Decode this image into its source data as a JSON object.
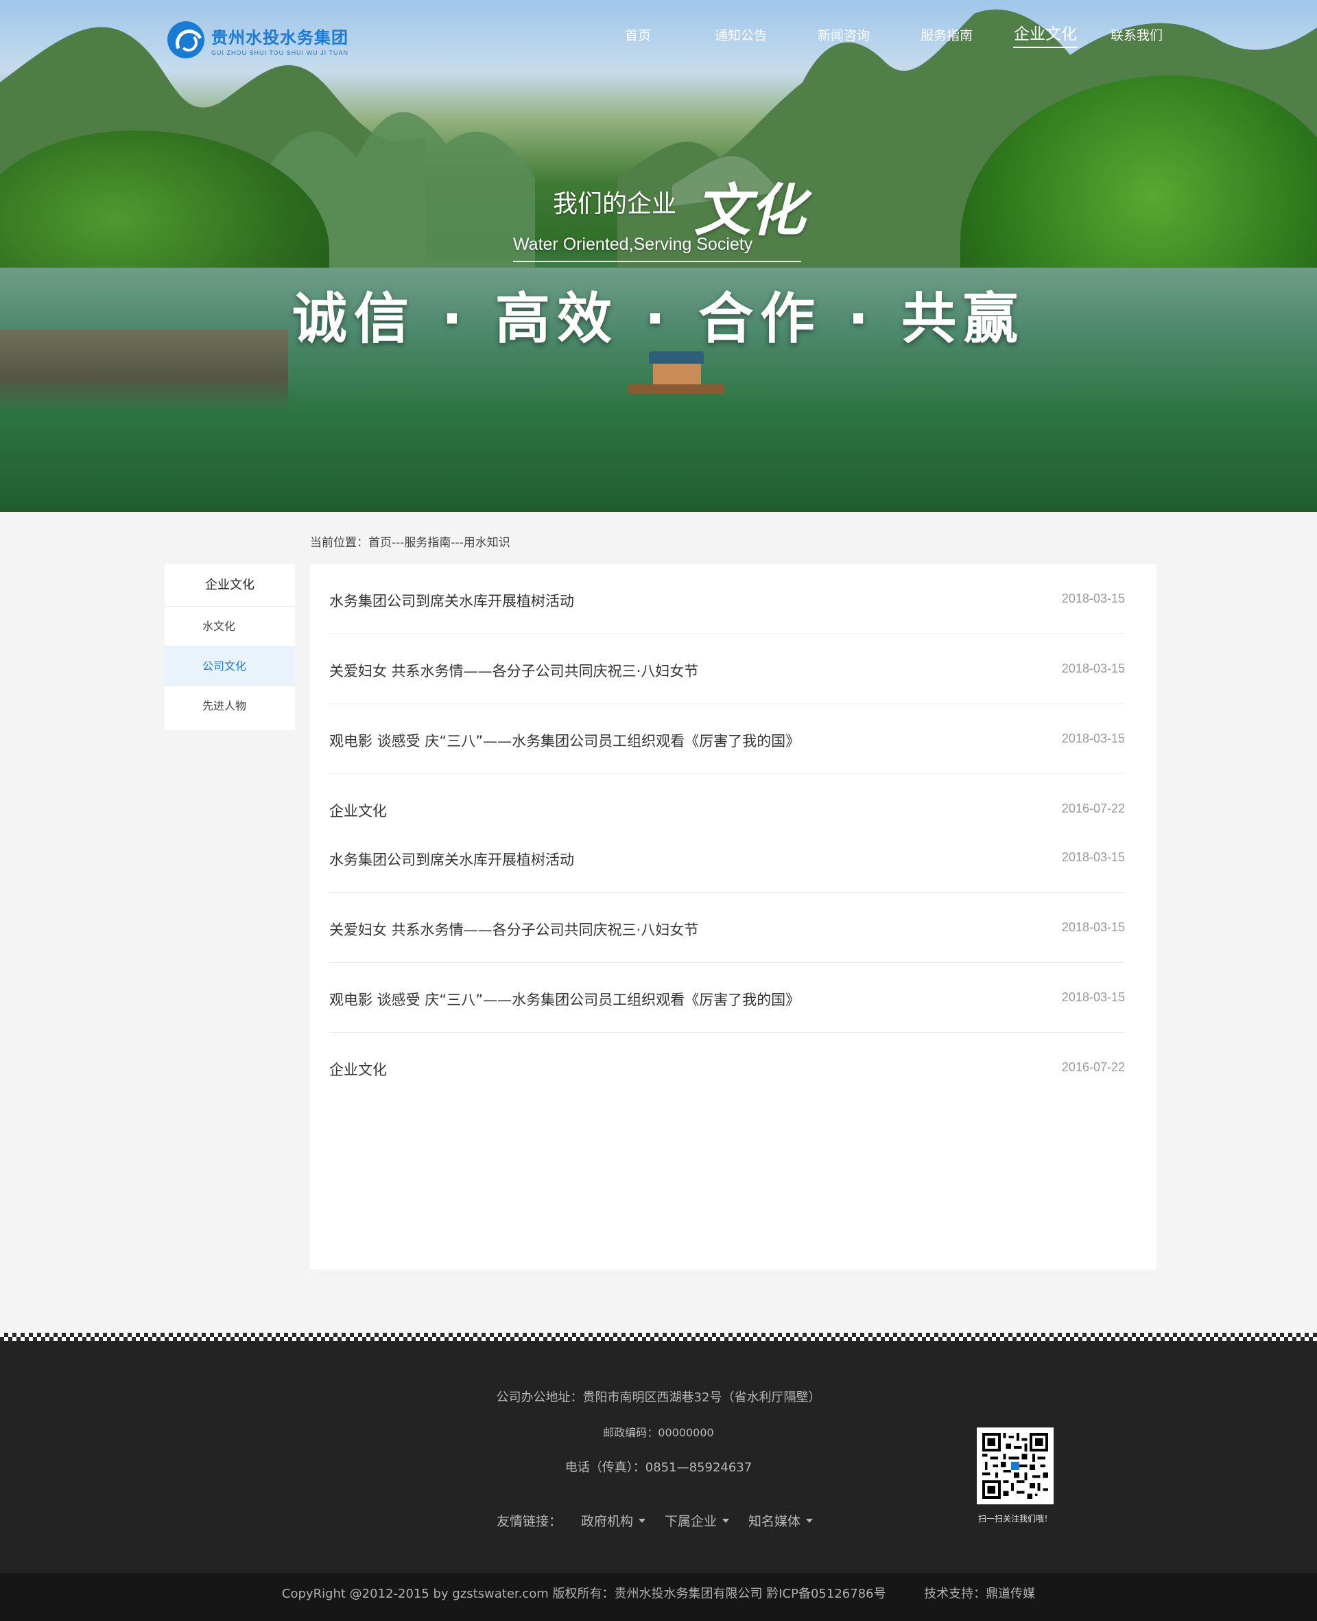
{
  "brand": {
    "name_cn": "贵州水投水务集团",
    "name_en": "GUI ZHOU SHUI TOU SHUI WU JI TUAN"
  },
  "nav": [
    {
      "label": "首页",
      "active": false
    },
    {
      "label": "通知公告",
      "active": false
    },
    {
      "label": "新闻咨询",
      "active": false
    },
    {
      "label": "服务指南",
      "active": false
    },
    {
      "label": "企业文化",
      "active": true
    },
    {
      "label": "联系我们",
      "active": false
    }
  ],
  "banner": {
    "line1": "我们的企业",
    "line1_big": "文化",
    "subtitle_en": "Water Oriented,Serving Society",
    "values": "诚信 · 高效 · 合作 · 共赢"
  },
  "breadcrumb": "当前位置：首页---服务指南---用水知识",
  "sidebar": {
    "title": "企业文化",
    "items": [
      {
        "label": "水文化",
        "active": false
      },
      {
        "label": "公司文化",
        "active": true
      },
      {
        "label": "先进人物",
        "active": false
      }
    ]
  },
  "news": [
    {
      "title": "水务集团公司到席关水库开展植树活动",
      "date": "2018-03-15"
    },
    {
      "title": "关爱妇女 共系水务情——各分子公司共同庆祝三·八妇女节",
      "date": "2018-03-15"
    },
    {
      "title": "观电影 谈感受 庆“三八”——水务集团公司员工组织观看《厉害了我的国》",
      "date": "2018-03-15"
    },
    {
      "title": "企业文化",
      "date": "2016-07-22"
    },
    {
      "title": "水务集团公司到席关水库开展植树活动",
      "date": "2018-03-15"
    },
    {
      "title": "关爱妇女 共系水务情——各分子公司共同庆祝三·八妇女节",
      "date": "2018-03-15"
    },
    {
      "title": "观电影 谈感受 庆“三八”——水务集团公司员工组织观看《厉害了我的国》",
      "date": "2018-03-15"
    },
    {
      "title": "企业文化",
      "date": "2016-07-22"
    }
  ],
  "footer": {
    "address": "公司办公地址：贵阳市南明区西湖巷32号（省水利厅隔壁）",
    "postcode": "邮政编码：00000000",
    "phone": "电话（传真）：0851—85924637",
    "links_label": "友情链接：",
    "link_groups": [
      "政府机构",
      "下属企业",
      "知名媒体"
    ],
    "qr_caption": "扫一扫关注我们哦！",
    "copyright": "CopyRight @2012-2015 by gzstswater.com 版权所有：贵州水投水务集团有限公司   黔ICP备05126786号",
    "support": "技术支持：鼎道传媒"
  },
  "colors": {
    "accent": "#1a7bd4",
    "footer_bg": "#232323",
    "copyright_bg": "#161616",
    "sidebar_active_bg": "#e9f3fb"
  }
}
